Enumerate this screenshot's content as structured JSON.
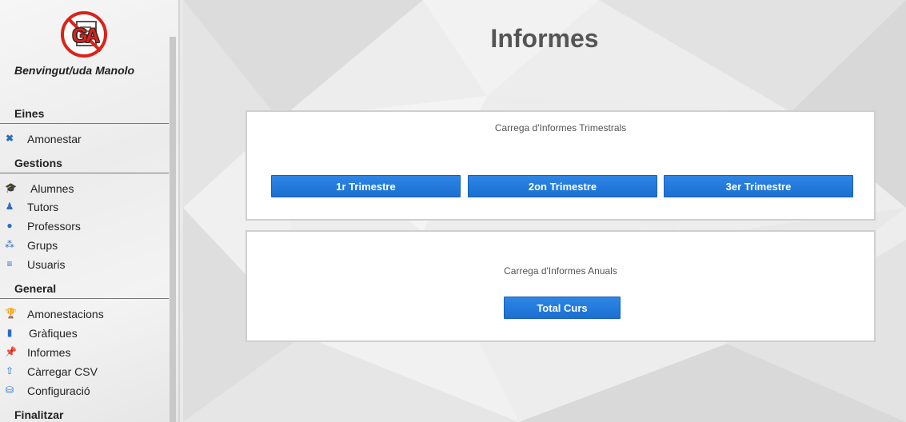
{
  "sidebar": {
    "welcome": "Benvingut/uda Manolo",
    "sections": {
      "eines": "Eines",
      "gestions": "Gestions",
      "general": "General"
    },
    "items": {
      "amonestar": "Amonestar",
      "alumnes": "Alumnes",
      "tutors": "Tutors",
      "professors": "Professors",
      "grups": "Grups",
      "usuaris": "Usuaris",
      "amonestacions": "Amonestacions",
      "grafiques": "Gràfiques",
      "informes": "Informes",
      "carregar_csv": "Càrregar CSV",
      "configuracio": "Configuració"
    },
    "finalitzar": "Finalitzar",
    "icons": {
      "amonestar": "close-icon",
      "alumnes": "graduation-cap-icon",
      "tutors": "user-tie-icon",
      "professors": "user-icon",
      "grups": "users-icon",
      "usuaris": "list-icon",
      "amonestacions": "trophy-icon",
      "grafiques": "bar-chart-icon",
      "informes": "pushpin-icon",
      "carregar_csv": "upload-icon",
      "configuracio": "database-icon"
    },
    "logo_text": "GA"
  },
  "main": {
    "title": "Informes",
    "trimestral_panel": {
      "title": "Carrega d'Informes Trimestrals",
      "buttons": [
        "1r Trimestre",
        "2on Trimestre",
        "3er Trimestre"
      ]
    },
    "anual_panel": {
      "title": "Carrega d'Informes Anuals",
      "button": "Total Curs"
    }
  },
  "colors": {
    "accent": "#1f77d8",
    "icon": "#2c6cc0",
    "logo_red": "#d9241b"
  }
}
